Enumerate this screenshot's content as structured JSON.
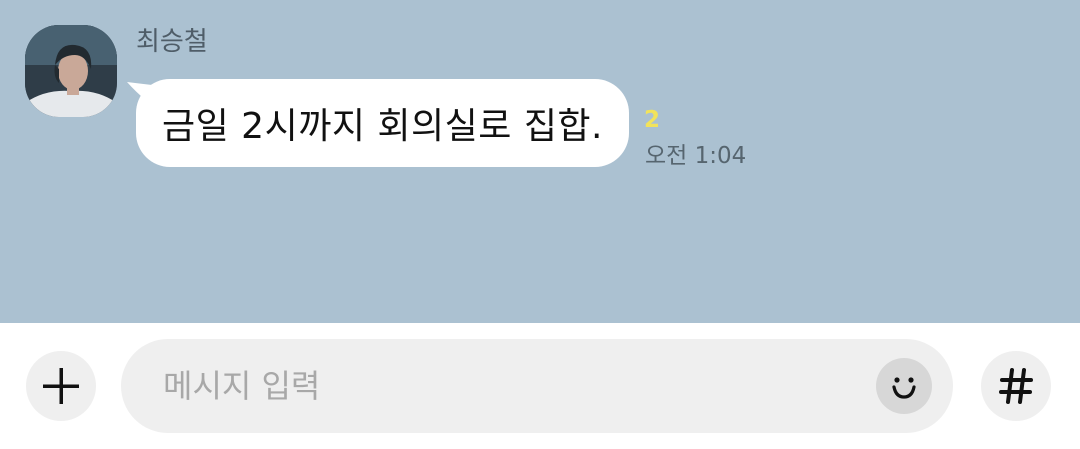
{
  "message": {
    "sender_name": "최승철",
    "text": "금일 2시까지 회의실로 집합.",
    "unread_count": "2",
    "time": "오전 1:04",
    "avatar_icon": "profile-photo"
  },
  "composer": {
    "placeholder": "메시지 입력",
    "plus_icon": "plus-icon",
    "emoji_icon": "emoji-icon",
    "hash_icon": "hash-icon"
  },
  "colors": {
    "chat_background": "#abc1d1",
    "bubble": "#ffffff",
    "unread": "#f2e35b",
    "input_background": "#efefef"
  }
}
